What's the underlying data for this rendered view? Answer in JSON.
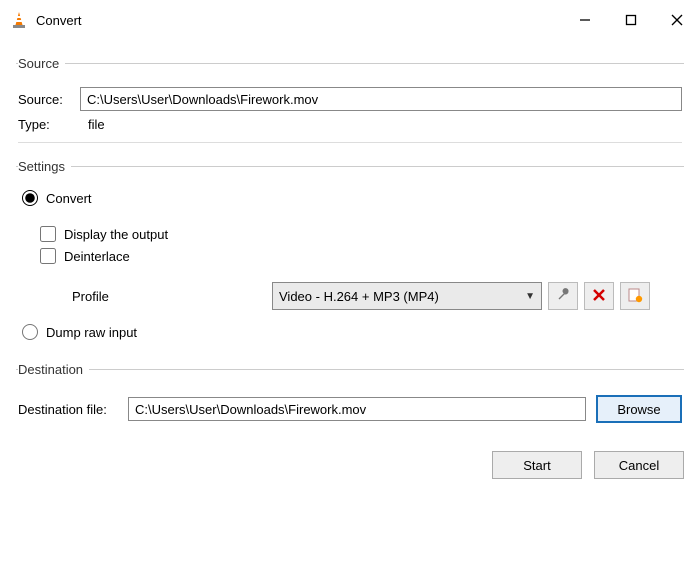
{
  "window": {
    "title": "Convert"
  },
  "source": {
    "legend": "Source",
    "label": "Source:",
    "value": "C:\\Users\\User\\Downloads\\Firework.mov",
    "type_label": "Type:",
    "type_value": "file"
  },
  "settings": {
    "legend": "Settings",
    "convert_label": "Convert",
    "display_output_label": "Display the output",
    "deinterlace_label": "Deinterlace",
    "profile_label": "Profile",
    "profile_value": "Video - H.264 + MP3 (MP4)",
    "dump_raw_label": "Dump raw input",
    "icon_tool": "wrench-icon",
    "icon_delete": "delete-icon",
    "icon_new": "new-profile-icon"
  },
  "destination": {
    "legend": "Destination",
    "label": "Destination file:",
    "value": "C:\\Users\\User\\Downloads\\Firework.mov",
    "browse_label": "Browse"
  },
  "buttons": {
    "start": "Start",
    "cancel": "Cancel"
  }
}
